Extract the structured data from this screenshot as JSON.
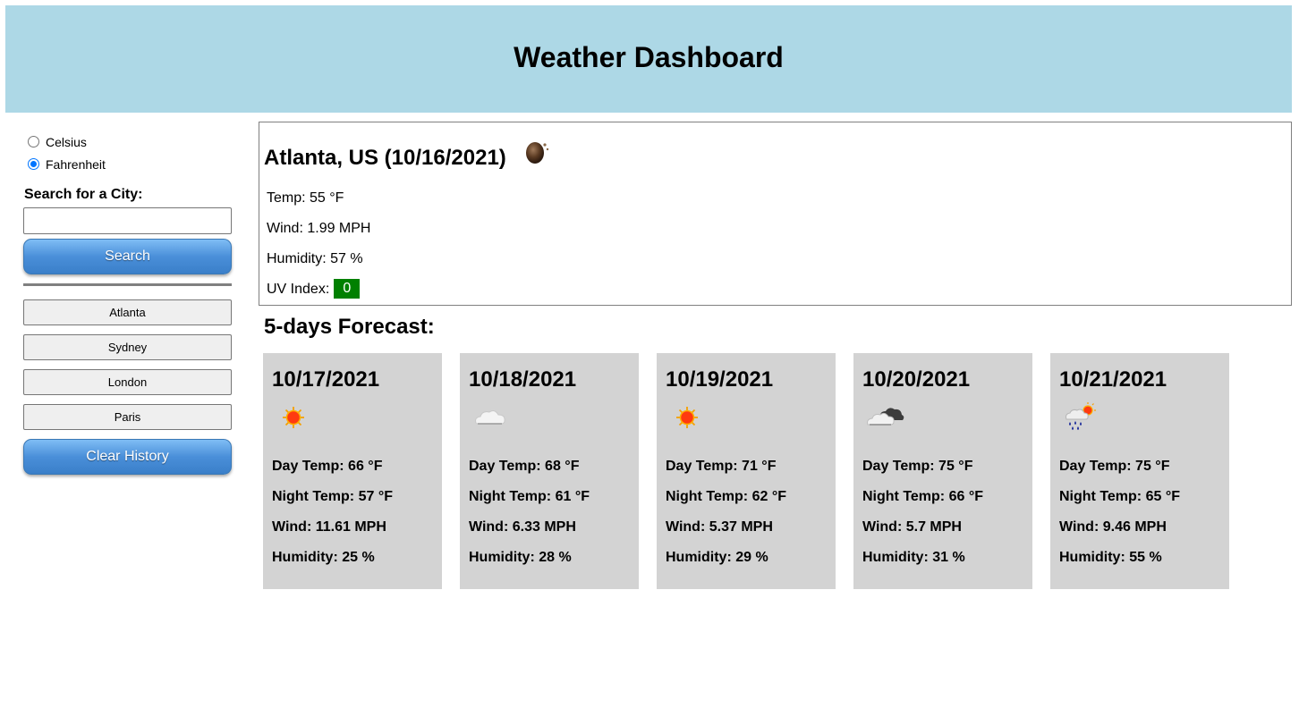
{
  "header": {
    "title": "Weather Dashboard"
  },
  "units": {
    "options": [
      {
        "label": "Celsius",
        "checked": false
      },
      {
        "label": "Fahrenheit",
        "checked": true
      }
    ]
  },
  "search": {
    "label": "Search for a City:",
    "value": "",
    "placeholder": "",
    "button_label": "Search"
  },
  "history": {
    "cities": [
      "Atlanta",
      "Sydney",
      "London",
      "Paris"
    ],
    "clear_label": "Clear History"
  },
  "current": {
    "title": "Atlanta, US (10/16/2021)",
    "icon": "clear-night-moon-icon",
    "temp": "Temp: 55 °F",
    "wind": "Wind: 1.99 MPH",
    "humidity": "Humidity: 57 %",
    "uv_label": "UV Index:",
    "uv_value": "0",
    "uv_color": "#008000"
  },
  "forecast": {
    "heading": "5-days Forecast:",
    "days": [
      {
        "date": "10/17/2021",
        "icon": "sun-icon",
        "day_temp": "Day Temp: 66 °F",
        "night_temp": "Night Temp: 57 °F",
        "wind": "Wind: 11.61 MPH",
        "humidity": "Humidity: 25 %"
      },
      {
        "date": "10/18/2021",
        "icon": "cloud-icon",
        "day_temp": "Day Temp: 68 °F",
        "night_temp": "Night Temp: 61 °F",
        "wind": "Wind: 6.33 MPH",
        "humidity": "Humidity: 28 %"
      },
      {
        "date": "10/19/2021",
        "icon": "sun-icon",
        "day_temp": "Day Temp: 71 °F",
        "night_temp": "Night Temp: 62 °F",
        "wind": "Wind: 5.37 MPH",
        "humidity": "Humidity: 29 %"
      },
      {
        "date": "10/20/2021",
        "icon": "broken-clouds-icon",
        "day_temp": "Day Temp: 75 °F",
        "night_temp": "Night Temp: 66 °F",
        "wind": "Wind: 5.7 MPH",
        "humidity": "Humidity: 31 %"
      },
      {
        "date": "10/21/2021",
        "icon": "rain-sun-icon",
        "day_temp": "Day Temp: 75 °F",
        "night_temp": "Night Temp: 65 °F",
        "wind": "Wind: 9.46 MPH",
        "humidity": "Humidity: 55 %"
      }
    ]
  },
  "colors": {
    "header_bg": "#add8e6",
    "card_bg": "#d3d3d3",
    "button_blue": "#4a8fd9"
  }
}
